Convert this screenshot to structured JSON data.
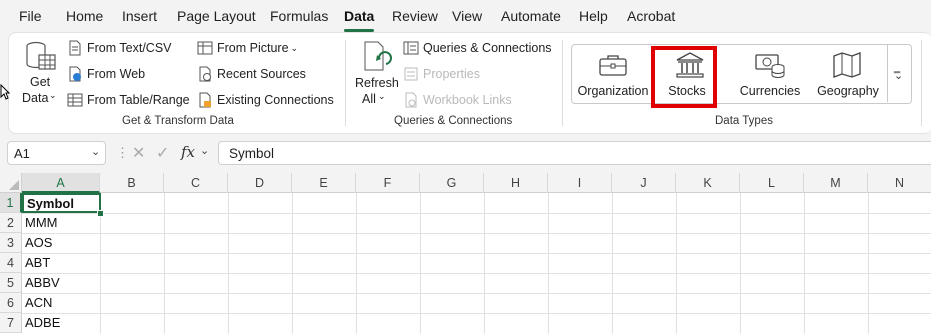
{
  "menu": {
    "tabs": [
      "File",
      "Home",
      "Insert",
      "Page Layout",
      "Formulas",
      "Data",
      "Review",
      "View",
      "Automate",
      "Help",
      "Acrobat"
    ],
    "active": "Data"
  },
  "ribbon": {
    "get_data": {
      "line1": "Get",
      "line2": "Data"
    },
    "get_transform": {
      "from_text_csv": "From Text/CSV",
      "from_web": "From Web",
      "from_table_range": "From Table/Range",
      "from_picture": "From Picture",
      "recent_sources": "Recent Sources",
      "existing_connections": "Existing Connections",
      "group_label": "Get & Transform Data"
    },
    "queries": {
      "refresh_line1": "Refresh",
      "refresh_line2": "All",
      "queries_connections": "Queries & Connections",
      "properties": "Properties",
      "workbook_links": "Workbook Links",
      "group_label": "Queries & Connections"
    },
    "data_types": {
      "organization": "Organization",
      "stocks": "Stocks",
      "currencies": "Currencies",
      "geography": "Geography",
      "group_label": "Data Types"
    }
  },
  "formula_bar": {
    "name_box": "A1",
    "fx": "fx",
    "value": "Symbol"
  },
  "grid": {
    "columns": [
      "A",
      "B",
      "C",
      "D",
      "E",
      "F",
      "G",
      "H",
      "I",
      "J",
      "K",
      "L",
      "M",
      "N"
    ],
    "rows": [
      "1",
      "2",
      "3",
      "4",
      "5",
      "6",
      "7"
    ],
    "column_a": [
      "Symbol",
      "MMM",
      "AOS",
      "ABT",
      "ABBV",
      "ACN",
      "ADBE"
    ]
  },
  "colors": {
    "accent": "#217346",
    "highlight": "#e00000"
  }
}
